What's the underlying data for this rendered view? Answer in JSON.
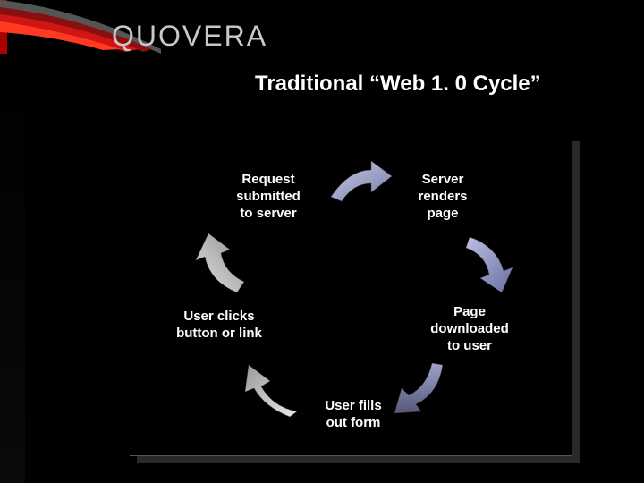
{
  "brand": {
    "name": "QUOVERA"
  },
  "slide": {
    "title": "Traditional “Web 1. 0 Cycle”"
  },
  "cycle": {
    "step1": "Request\nsubmitted\nto server",
    "step2": "Server\nrenders\npage",
    "step3": "Page\ndownloaded\nto user",
    "step4": "User fills\nout form",
    "step5": "User clicks\nbutton or link"
  }
}
